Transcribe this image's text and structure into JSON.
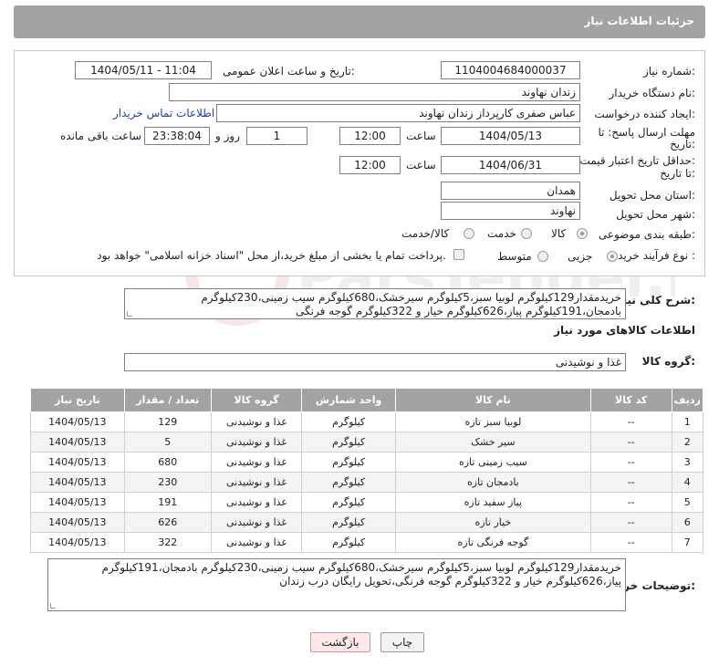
{
  "header": {
    "title": "جزئیات اطلاعات نیاز"
  },
  "form": {
    "need_number": {
      "label": "شماره نیاز:",
      "value": "1104004684000037"
    },
    "announce_datetime": {
      "label": "تاریخ و ساعت اعلان عمومی:",
      "value": "1404/05/11 - 11:04"
    },
    "buyer_org": {
      "label": "نام دستگاه خریدار:",
      "value": "زندان نهاوند"
    },
    "requester": {
      "label": "ایجاد کننده درخواست:",
      "value": "عباس صفری کارپرداز زندان نهاوند",
      "contact_link": "اطلاعات تماس خریدار"
    },
    "reply_deadline": {
      "label_line1": "مهلت ارسال پاسخ: تا",
      "label_line2": "تاریخ:",
      "date": "1404/05/13",
      "time_label": "ساعت",
      "time": "12:00",
      "days": "1",
      "days_label": "روز و",
      "remaining": "23:38:04",
      "remaining_label": "ساعت باقی مانده"
    },
    "price_validity": {
      "label_line1": "حداقل تاریخ اعتبار قیمت:",
      "label_line2": "تا تاریخ:",
      "date": "1404/06/31",
      "time_label": "ساعت",
      "time": "12:00"
    },
    "province": {
      "label": "استان محل تحویل:",
      "value": "همدان"
    },
    "city": {
      "label": "شهر محل تحویل:",
      "value": "نهاوند"
    },
    "category": {
      "label": "طبقه بندی موضوعی:",
      "options": [
        "کالا",
        "خدمت",
        "کالا/خدمت"
      ],
      "selected": "کالا"
    },
    "purchase_type": {
      "label": "نوع فرآیند خرید :",
      "options": [
        "جزیی",
        "متوسط"
      ],
      "selected": "جزیی",
      "payment_note": "پرداخت تمام یا بخشی از مبلغ خرید،از محل \"اسناد خزانه اسلامی\" خواهد بود."
    }
  },
  "description": {
    "label": "شرح کلی نیاز:",
    "value": "خریدمقدار129کیلوگرم لوبیا سبز،5کیلوگرم سیرخشک،680کیلوگرم سیب زمینی،230کیلوگرم بادمجان،191کیلوگرم پیاز،626کیلوگرم خیار و 322کیلوگرم گوجه فرنگی"
  },
  "goods_section": {
    "title": "اطلاعات کالاهای مورد نیاز",
    "group_label": "گروه کالا:",
    "group_value": "غذا و نوشیدنی"
  },
  "table": {
    "headers": [
      "ردیف",
      "کد کالا",
      "نام کالا",
      "واحد شمارش",
      "گروه کالا",
      "تعداد / مقدار",
      "تاریخ نیاز"
    ],
    "rows": [
      [
        "1",
        "--",
        "لوبیا سبز تازه",
        "کیلوگرم",
        "غذا و نوشیدنی",
        "129",
        "1404/05/13"
      ],
      [
        "2",
        "--",
        "سیر خشک",
        "کیلوگرم",
        "غذا و نوشیدنی",
        "5",
        "1404/05/13"
      ],
      [
        "3",
        "--",
        "سیب زمینی تازه",
        "کیلوگرم",
        "غذا و نوشیدنی",
        "680",
        "1404/05/13"
      ],
      [
        "4",
        "--",
        "بادمجان تازه",
        "کیلوگرم",
        "غذا و نوشیدنی",
        "230",
        "1404/05/13"
      ],
      [
        "5",
        "--",
        "پیاز سفید تازه",
        "کیلوگرم",
        "غذا و نوشیدنی",
        "191",
        "1404/05/13"
      ],
      [
        "6",
        "--",
        "خیار تازه",
        "کیلوگرم",
        "غذا و نوشیدنی",
        "626",
        "1404/05/13"
      ],
      [
        "7",
        "--",
        "گوجه فرنگی تازه",
        "کیلوگرم",
        "غذا و نوشیدنی",
        "322",
        "1404/05/13"
      ]
    ]
  },
  "buyer_notes": {
    "label": "توضیحات خریدار:",
    "value": "خریدمقدار129کیلوگرم لوبیا سبز،5کیلوگرم سیرخشک،680کیلوگرم سیب زمینی،230کیلوگرم بادمجان،191کیلوگرم پیاز،626کیلوگرم خیار و 322کیلوگرم گوجه فرنگی،تحویل رایگان درب زندان"
  },
  "buttons": {
    "print": "چاپ",
    "back": "بازگشت"
  },
  "watermark": {
    "text": "ParsTender.net"
  }
}
